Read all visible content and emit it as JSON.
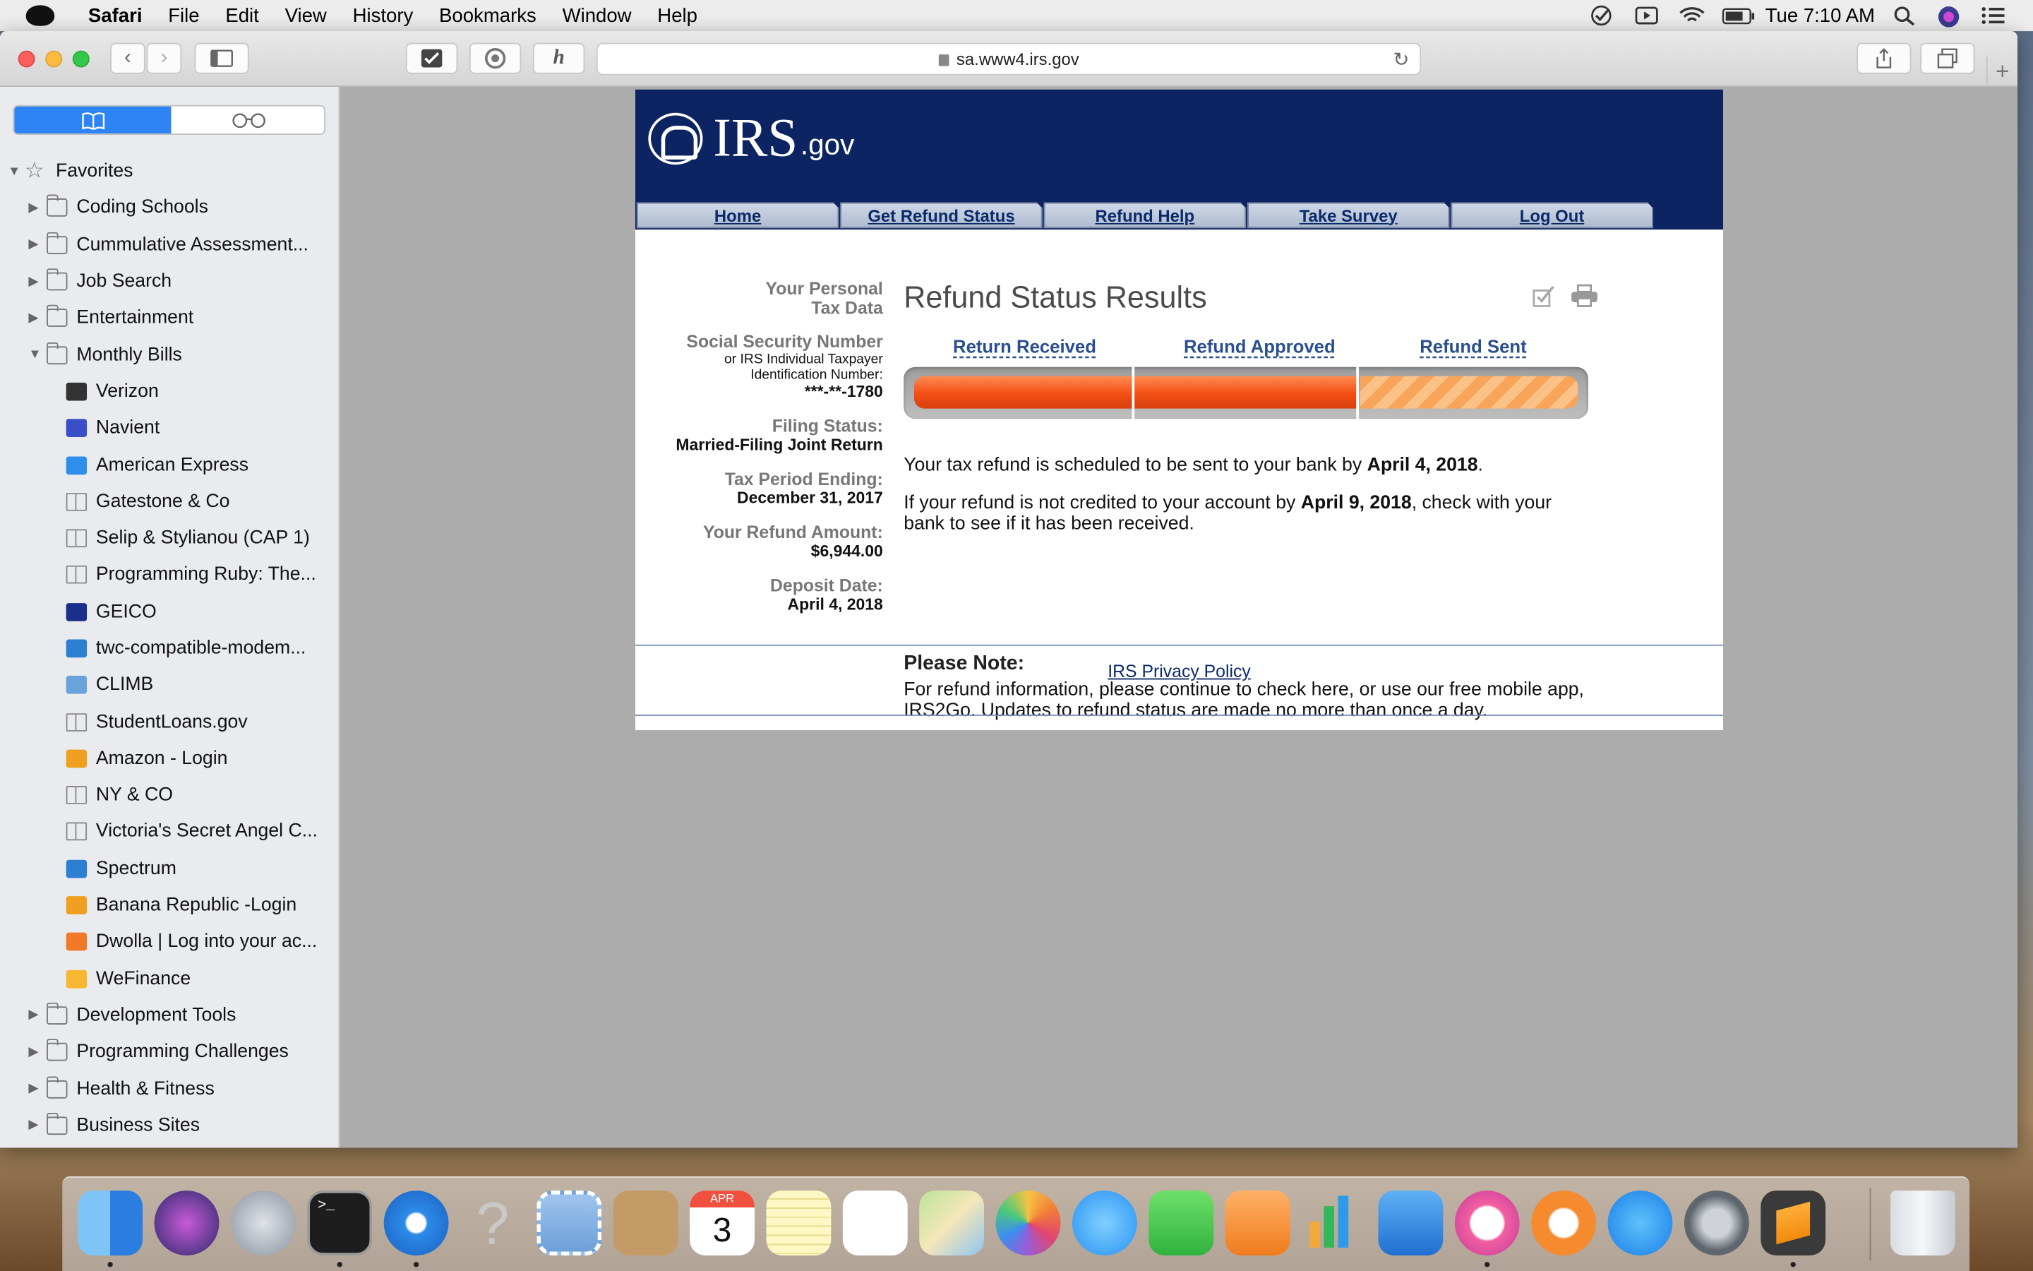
{
  "menubar": {
    "app": "Safari",
    "items": [
      "File",
      "Edit",
      "View",
      "History",
      "Bookmarks",
      "Window",
      "Help"
    ],
    "clock": "Tue 7:10 AM"
  },
  "browser": {
    "url": "sa.www4.irs.gov"
  },
  "sidebar": {
    "favorites": "Favorites",
    "items": [
      {
        "label": "Coding Schools",
        "kind": "folder",
        "level": 1,
        "expanded": false
      },
      {
        "label": "Cummulative Assessment...",
        "kind": "folder",
        "level": 1,
        "expanded": false
      },
      {
        "label": "Job Search",
        "kind": "folder",
        "level": 1,
        "expanded": false
      },
      {
        "label": "Entertainment",
        "kind": "folder",
        "level": 1,
        "expanded": false
      },
      {
        "label": "Monthly Bills",
        "kind": "folder",
        "level": 1,
        "expanded": true
      },
      {
        "label": "Verizon",
        "kind": "site",
        "icon": "verizon-icon",
        "color": "#333333"
      },
      {
        "label": "Navient",
        "kind": "site",
        "icon": "navient-icon",
        "color": "#3a4fc7"
      },
      {
        "label": "American Express",
        "kind": "site",
        "icon": "amex-icon",
        "color": "#2f8fe8"
      },
      {
        "label": "Gatestone & Co",
        "kind": "book"
      },
      {
        "label": "Selip & Stylianou (CAP 1)",
        "kind": "book"
      },
      {
        "label": "Programming Ruby: The...",
        "kind": "book"
      },
      {
        "label": "GEICO",
        "kind": "site",
        "icon": "geico-icon",
        "color": "#1b2f8a"
      },
      {
        "label": "twc-compatible-modem...",
        "kind": "site",
        "icon": "play-icon",
        "color": "#2c7fd1"
      },
      {
        "label": "CLIMB",
        "kind": "site",
        "icon": "doc-icon",
        "color": "#6aa2dc"
      },
      {
        "label": "StudentLoans.gov",
        "kind": "book"
      },
      {
        "label": "Amazon - Login",
        "kind": "site",
        "icon": "bars-icon",
        "color": "#f0a020"
      },
      {
        "label": "NY & CO",
        "kind": "book"
      },
      {
        "label": "Victoria's Secret Angel C...",
        "kind": "book"
      },
      {
        "label": "Spectrum",
        "kind": "site",
        "icon": "play-icon",
        "color": "#2c7fd1"
      },
      {
        "label": "Banana Republic -Login",
        "kind": "site",
        "icon": "bars-icon",
        "color": "#f0a020"
      },
      {
        "label": "Dwolla | Log into your ac...",
        "kind": "site",
        "icon": "dwolla-icon",
        "color": "#f07a2a"
      },
      {
        "label": "WeFinance",
        "kind": "site",
        "icon": "wefinance-icon",
        "color": "#f7b733"
      },
      {
        "label": "Development Tools",
        "kind": "folder",
        "level": 1,
        "expanded": false
      },
      {
        "label": "Programming Challenges",
        "kind": "folder",
        "level": 1,
        "expanded": false
      },
      {
        "label": "Health & Fitness",
        "kind": "folder",
        "level": 1,
        "expanded": false
      },
      {
        "label": "Business Sites",
        "kind": "folder",
        "level": 1,
        "expanded": false
      }
    ]
  },
  "irs": {
    "logo_main": "IRS",
    "logo_suffix": ".gov",
    "nav": [
      "Home",
      "Get Refund Status",
      "Refund Help",
      "Take Survey",
      "Log Out"
    ],
    "personal_data_label_1": "Your Personal",
    "personal_data_label_2": "Tax Data",
    "ssn_label": "Social Security Number",
    "ssn_sub_1": "or IRS Individual Taxpayer",
    "ssn_sub_2": "Identification Number:",
    "ssn_value": "***-**-1780",
    "filing_label": "Filing Status:",
    "filing_value": "Married-Filing Joint Return",
    "period_label": "Tax Period Ending:",
    "period_value": "December 31, 2017",
    "amount_label": "Your Refund Amount:",
    "amount_value": "$6,944.00",
    "deposit_label": "Deposit Date:",
    "deposit_value": "April 4, 2018",
    "title": "Refund Status Results",
    "steps": [
      "Return Received",
      "Refund Approved",
      "Refund Sent"
    ],
    "progress_stage": 2,
    "progress_total": 3,
    "msg1_a": "Your tax refund is scheduled to be sent to your bank by ",
    "msg1_b": "April 4, 2018",
    "msg1_c": ".",
    "msg2_a": "If your refund is not credited to your account by ",
    "msg2_b": "April 9, 2018",
    "msg2_c": ", check with your bank to see if it has been received.",
    "note_title": "Please Note:",
    "note_text": "For refund information, please continue to check here, or use our free mobile app, IRS2Go. Updates to refund status are made no more than once a day.",
    "privacy": "IRS Privacy Policy"
  },
  "dock": {
    "calendar_month": "APR",
    "calendar_day": "3",
    "apps": [
      "finder-icon",
      "siri-icon",
      "launchpad-icon",
      "terminal-icon",
      "safari-icon",
      "unknown-app-icon",
      "mail-stamp-icon",
      "contacts-icon",
      "calendar-icon",
      "notes-icon",
      "reminders-icon",
      "maps-icon",
      "photos-icon",
      "messages-icon",
      "facetime-icon",
      "pages-icon",
      "numbers-icon",
      "keynote-icon",
      "itunes-icon",
      "ibooks-icon",
      "app-store-icon",
      "system-preferences-icon",
      "sublime-text-icon",
      "trash-icon"
    ]
  }
}
